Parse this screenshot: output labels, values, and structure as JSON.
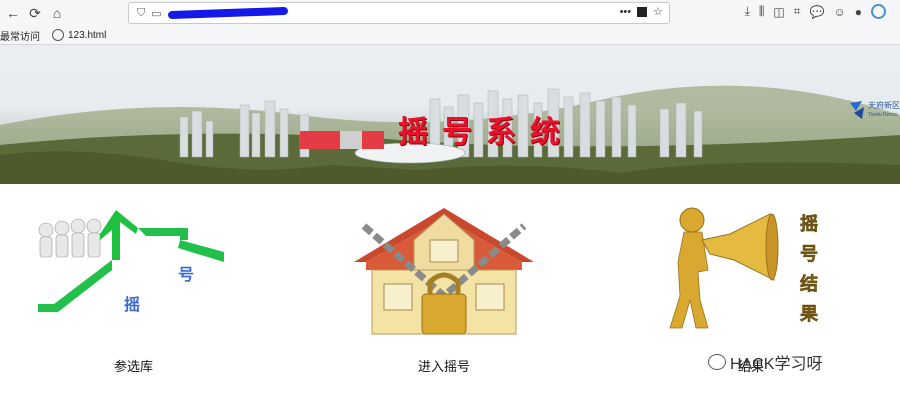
{
  "browser": {
    "nav": {
      "back_icon": "back-arrow-icon",
      "reload_icon": "reload-icon",
      "home_icon": "home-icon"
    },
    "url_menu": "•••",
    "toolbar_icons": [
      "download-icon",
      "library-icon",
      "sidebar-icon",
      "screenshot-icon",
      "chat-icon",
      "face-icon",
      "account-icon",
      "firefox-account-icon"
    ]
  },
  "bookmarks": [
    {
      "label": "最常访问"
    },
    {
      "label": "123.html"
    }
  ],
  "banner": {
    "title": "摇号系统",
    "brand_cn": "天府新区",
    "brand_en": "Tianfu Renzu"
  },
  "cards": [
    {
      "label": "参选库",
      "icon": "house-people-icon",
      "overlay_text": [
        "摇",
        "号"
      ]
    },
    {
      "label": "进入摇号",
      "icon": "locked-house-icon"
    },
    {
      "label": "结果",
      "icon": "megaphone-man-icon",
      "overlay_text": [
        "摇",
        "号",
        "结",
        "果"
      ]
    }
  ],
  "watermark": {
    "text": "HACK学习呀"
  },
  "colors": {
    "title_red": "#e8132a",
    "green": "#22c04a",
    "gold": "#c8a12a"
  }
}
